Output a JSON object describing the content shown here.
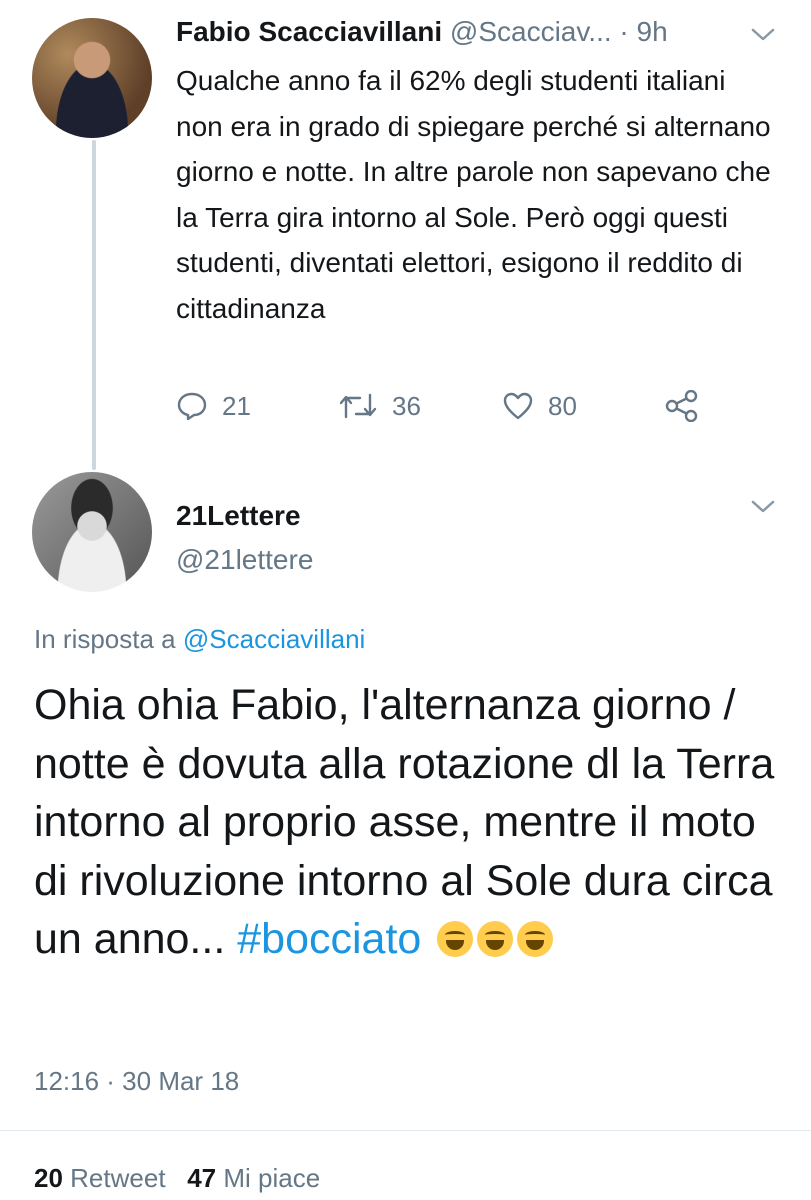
{
  "tweet1": {
    "author_name": "Fabio Scacciavillani",
    "handle": "@Scacciav...",
    "separator": "·",
    "time": "9h",
    "text": "Qualche anno fa il 62% degli studenti italiani non era in grado di spiegare perché si alternano giorno e notte. In altre parole non sapevano che la Terra gira intorno al Sole. Però oggi questi studenti, diventati elettori, esigono il reddito di cittadinanza",
    "actions": {
      "replies": "21",
      "retweets": "36",
      "likes": "80"
    }
  },
  "tweet2": {
    "author_name": "21Lettere",
    "handle": "@21lettere",
    "reply_prefix": "In risposta a",
    "reply_mention": "@Scacciavillani",
    "text": "Ohia ohia Fabio, l'alternanza giorno / notte è dovuta alla rotazione dl la Terra intorno al proprio asse, mentre il moto di rivoluzione intorno al Sole dura circa un anno...",
    "hashtag": "#bocciato",
    "emoji_name": "face-with-tears-of-joy",
    "timestamp": "12:16 · 30 Mar 18",
    "stats": {
      "retweet_count": "20",
      "retweet_label": "Retweet",
      "like_count": "47",
      "like_label": "Mi piace"
    }
  },
  "icons": {
    "chevron": "chevron-down-icon",
    "reply": "reply-icon",
    "retweet": "retweet-icon",
    "like": "heart-icon",
    "share": "share-icon"
  },
  "colors": {
    "link": "#1b95e0",
    "secondary_text": "#657786",
    "primary_text": "#14171a",
    "thread_line": "#ccd6dd"
  }
}
